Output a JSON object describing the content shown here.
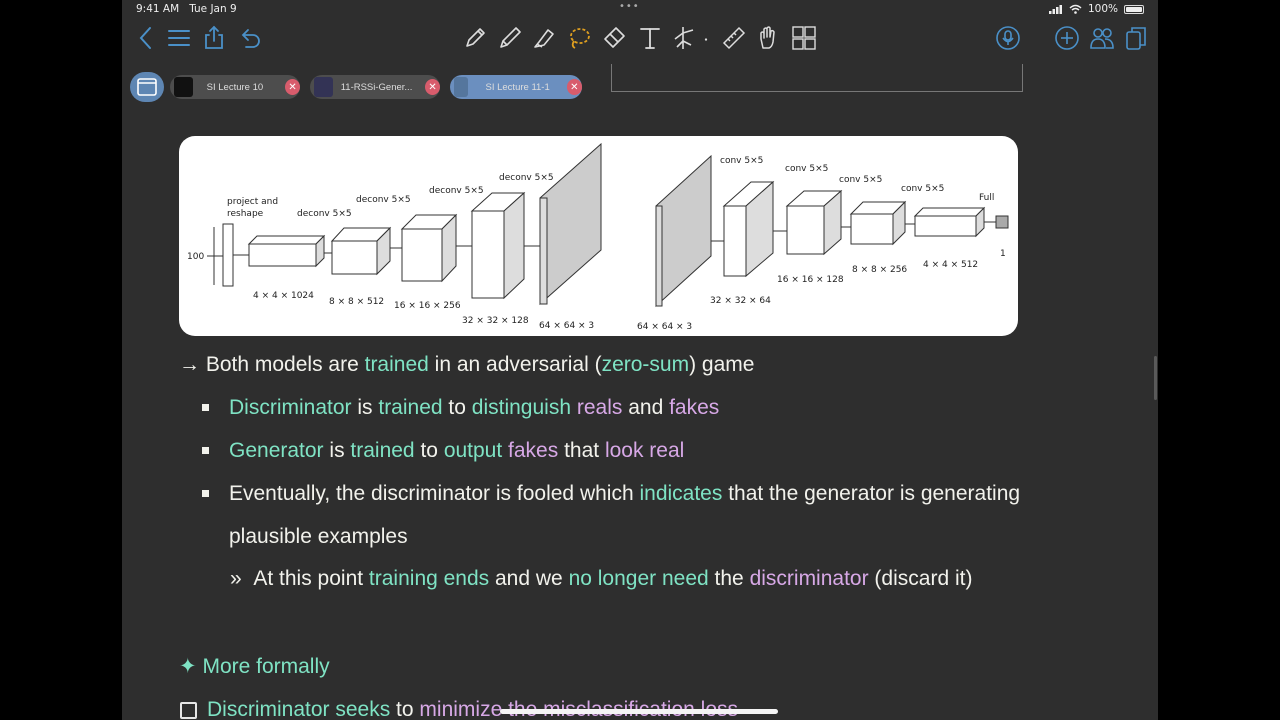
{
  "status_bar": {
    "time": "9:41 AM",
    "date": "Tue Jan 9",
    "battery": "100%"
  },
  "toolbar": {
    "left_icons": [
      "back-chevron-icon",
      "list-icon",
      "share-icon",
      "undo-icon"
    ],
    "tools": [
      "pen-icon",
      "pencil-icon",
      "highlighter-icon",
      "lasso-icon",
      "eraser-icon",
      "text-icon",
      "shapes-icon",
      "ruler-icon",
      "hand-icon",
      "grid-icon"
    ],
    "right_icons": [
      "microphone-icon",
      "add-icon",
      "users-icon",
      "pages-icon"
    ],
    "accent": "#4a90c8",
    "active_tool_color": "#e0a020"
  },
  "tabs": [
    {
      "label": "SI Lecture 10",
      "active": false
    },
    {
      "label": "11-RSSi-Gener...",
      "active": false
    },
    {
      "label": "SI Lecture 11-1",
      "active": true
    }
  ],
  "figure": {
    "generator": {
      "input": "100",
      "project_label_1": "project and",
      "project_label_2": "reshape",
      "layers": [
        {
          "op": "deconv 5×5",
          "shape": "4 × 4 × 1024"
        },
        {
          "op": "deconv 5×5",
          "shape": "8 × 8 × 512"
        },
        {
          "op": "deconv 5×5",
          "shape": "16 × 16 × 256"
        },
        {
          "op": "deconv 5×5",
          "shape": "32 × 32 × 128"
        },
        {
          "op": "",
          "shape": "64 × 64 × 3"
        }
      ]
    },
    "discriminator": {
      "layers": [
        {
          "op": "",
          "shape": "64 × 64 × 3"
        },
        {
          "op": "conv 5×5",
          "shape": "32 × 32 × 64"
        },
        {
          "op": "conv 5×5",
          "shape": "16 × 16 × 128"
        },
        {
          "op": "conv 5×5",
          "shape": "8 × 8 × 256"
        },
        {
          "op": "conv 5×5",
          "shape": "4 × 4 × 512"
        }
      ],
      "output_op": "Full",
      "output_shape": "1"
    }
  },
  "notes": {
    "line1": {
      "arrow": "→",
      "a": "Both models are ",
      "b": "trained",
      "c": " in an adversarial (",
      "d": "zero-sum",
      "e": ") game"
    },
    "line2": {
      "a": "Discriminator",
      "b": " is ",
      "c": "trained",
      "d": " to ",
      "e": "distinguish",
      "f": " ",
      "g": "reals",
      "h": " and ",
      "i": "fakes"
    },
    "line3": {
      "a": "Generator",
      "b": " is ",
      "c": "trained",
      "d": " to ",
      "e": "output",
      "f": " ",
      "g": "fakes",
      "h": " that ",
      "i": "look real"
    },
    "line4": {
      "a": "Eventually, the discriminator is fooled which ",
      "b": "indicates",
      "c": " that the generator is generating"
    },
    "line5": "plausible examples",
    "line6": {
      "marker": "»",
      "a": "At this point ",
      "b": "training ends",
      "c": " and we ",
      "d": "no longer need",
      "e": " the ",
      "f": "discriminator",
      "g": " (discard it)"
    },
    "heading": {
      "star": "✦",
      "text": "More formally"
    },
    "line7": {
      "a": "Discriminator seeks",
      "b": " to ",
      "c": "minimize",
      "d": " the misclassification loss"
    }
  }
}
